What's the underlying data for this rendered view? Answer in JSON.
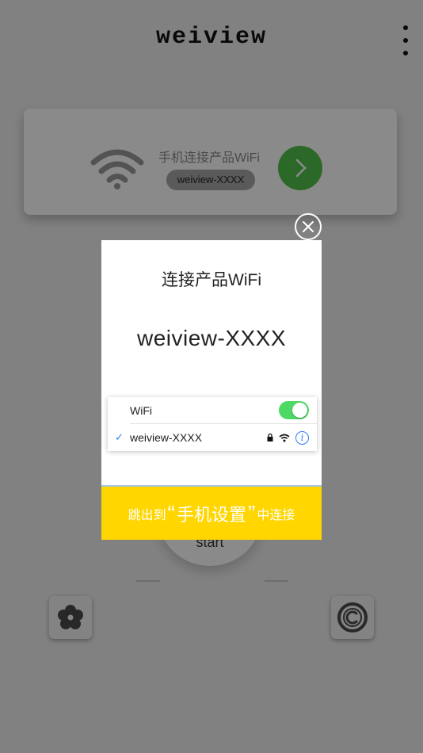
{
  "app": {
    "title": "weiview"
  },
  "wifi_card": {
    "title": "手机连接产品WiFi",
    "ssid": "weiview-XXXX",
    "icons": {
      "wifi": "wifi-icon",
      "go": "chevron-right-icon"
    }
  },
  "start": {
    "label": "start"
  },
  "bottom_icons": {
    "left": "flower-icon",
    "right": "copyright-icon"
  },
  "dialog": {
    "title": "连接产品WiFi",
    "ssid": "weiview-XXXX",
    "panel": {
      "wifi_label": "WiFi",
      "wifi_enabled": true,
      "network_name": "weiview-XXXX",
      "checkmark": "✓",
      "info": "i"
    },
    "action": {
      "prefix": "跳出到",
      "open_quote": "“",
      "target": "手机设置",
      "close_quote": "”",
      "suffix": "中连接"
    }
  },
  "colors": {
    "accent_yellow": "#ffd600",
    "go_green": "#52c14a",
    "toggle_green": "#4cd964",
    "ios_blue": "#2f7cf6"
  }
}
